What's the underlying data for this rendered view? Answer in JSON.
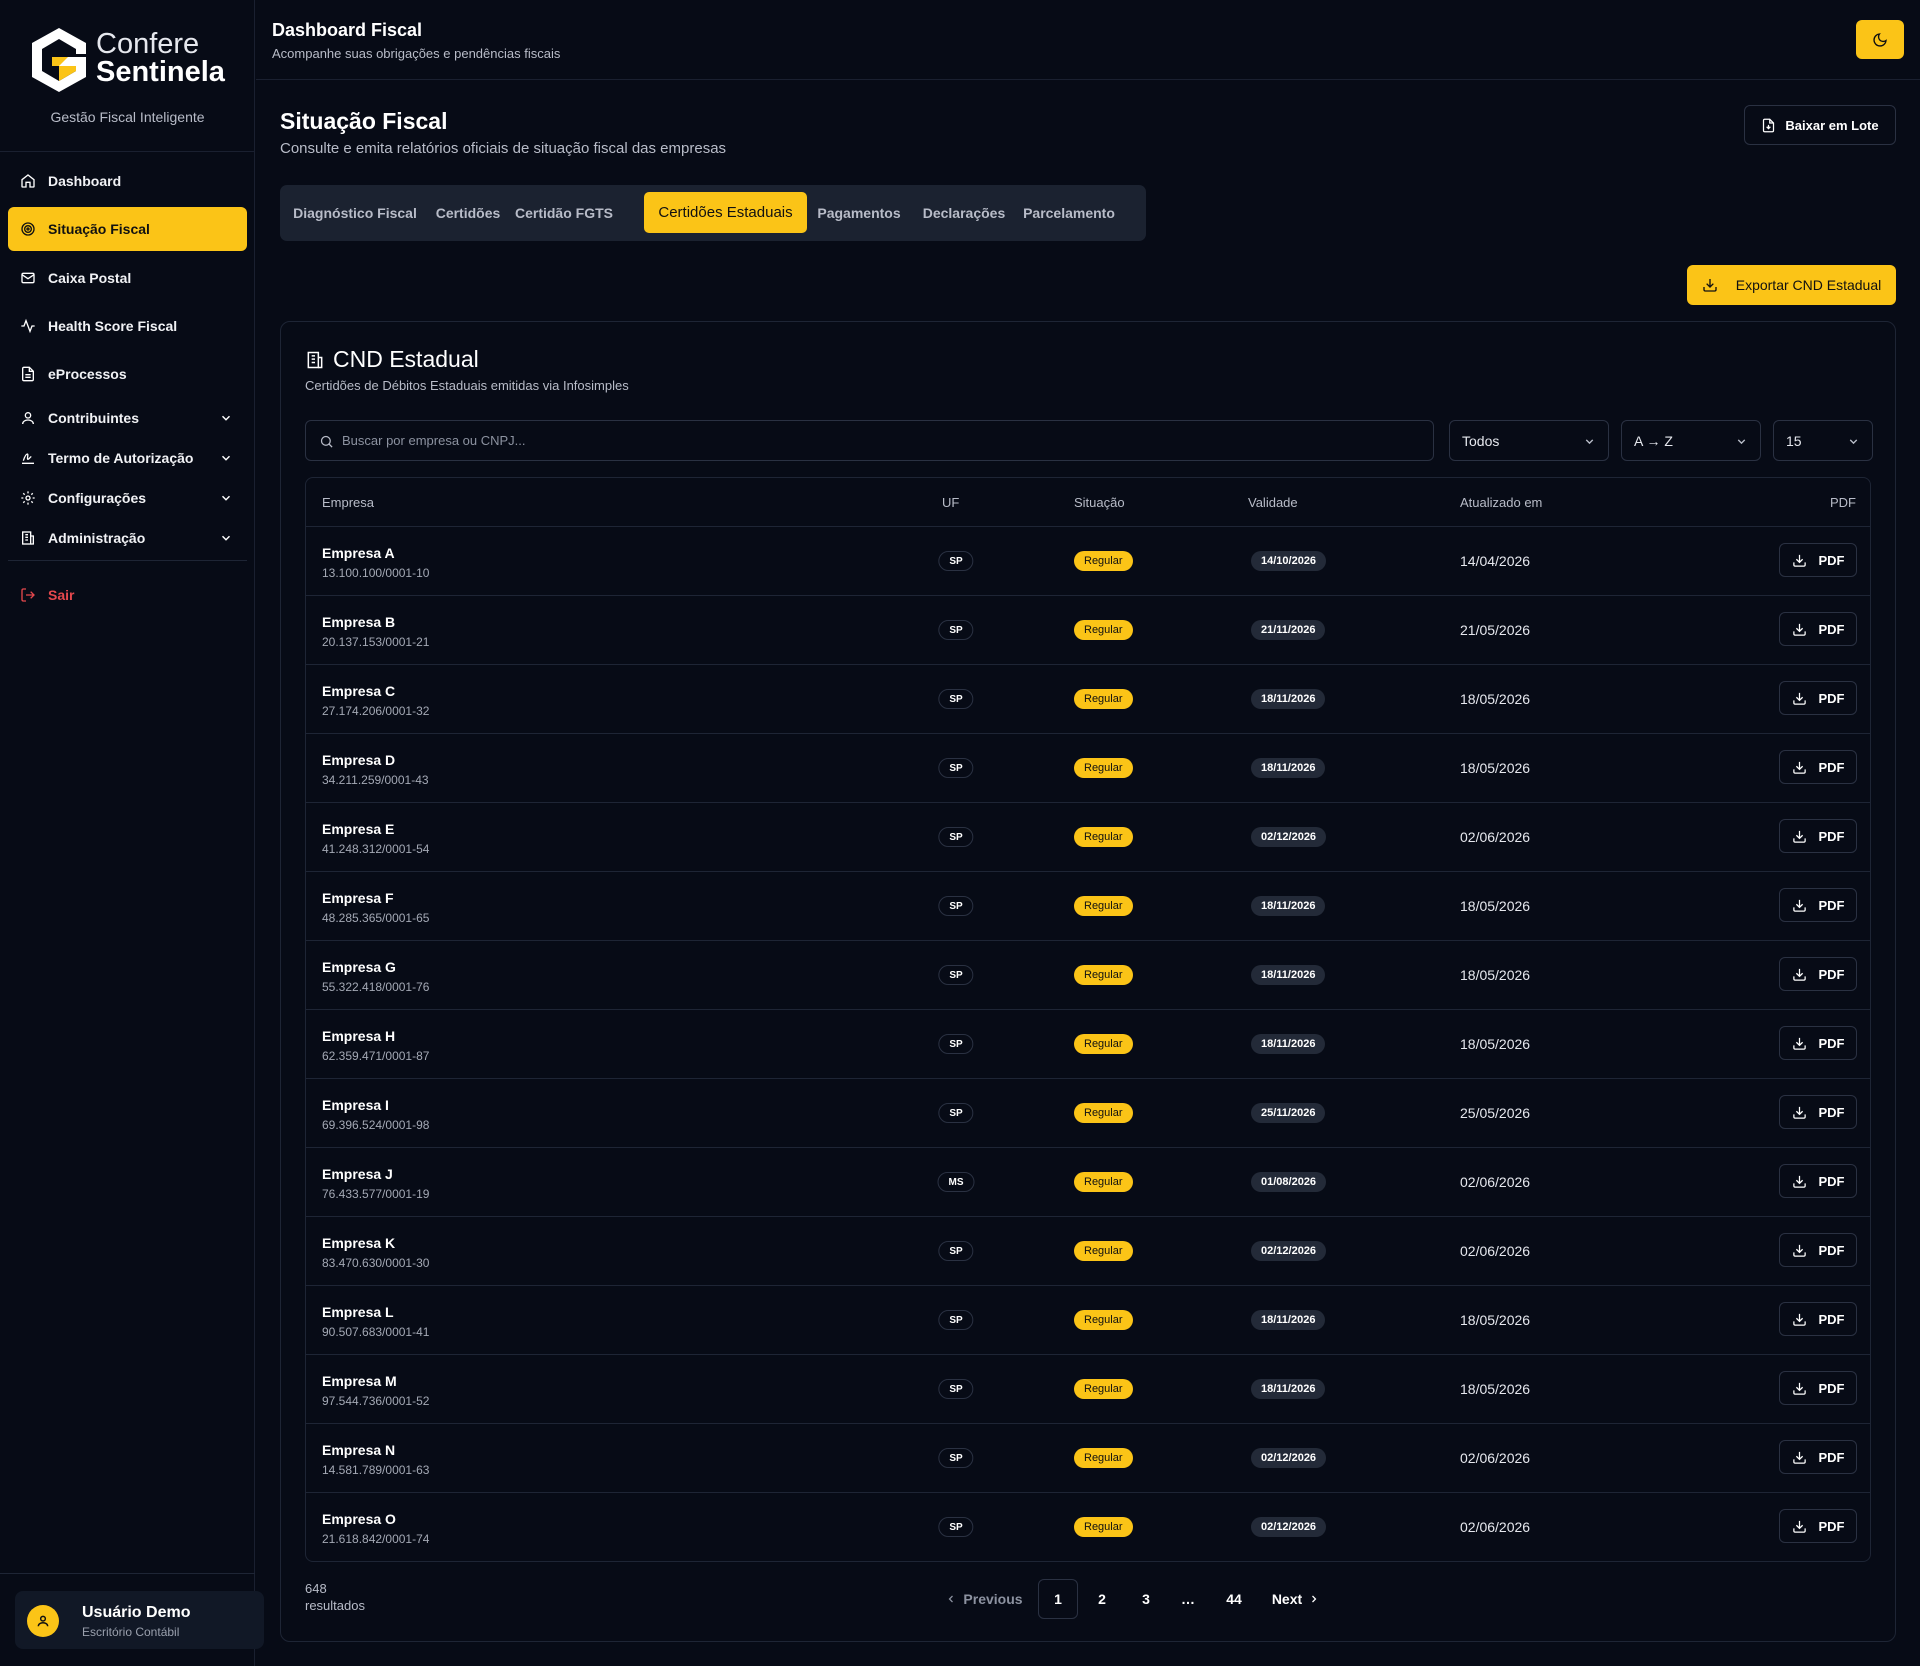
{
  "brand": {
    "name_line1": "Confere",
    "name_line2": "Sentinela",
    "tagline": "Gestão Fiscal Inteligente",
    "accent": "#fbc417"
  },
  "sidebar": {
    "items": [
      {
        "label": "Dashboard",
        "icon": "home-icon"
      },
      {
        "label": "Situação Fiscal",
        "icon": "target-icon",
        "active": true
      },
      {
        "label": "Caixa Postal",
        "icon": "mail-icon"
      },
      {
        "label": "Health Score Fiscal",
        "icon": "activity-icon"
      },
      {
        "label": "eProcessos",
        "icon": "file-text-icon"
      },
      {
        "label": "Contribuintes",
        "icon": "user-icon",
        "expandable": true
      },
      {
        "label": "Termo de Autorização",
        "icon": "signature-icon",
        "expandable": true
      },
      {
        "label": "Configurações",
        "icon": "gear-icon",
        "expandable": true
      },
      {
        "label": "Administração",
        "icon": "building-icon",
        "expandable": true
      }
    ],
    "logout": "Sair",
    "user": {
      "name": "Usuário Demo",
      "role": "Escritório Contábil"
    }
  },
  "topbar": {
    "title": "Dashboard Fiscal",
    "subtitle": "Acompanhe suas obrigações e pendências fiscais",
    "theme_icon": "moon-icon"
  },
  "page": {
    "title": "Situação Fiscal",
    "subtitle": "Consulte e emita relatórios oficiais de situação fiscal das empresas",
    "batch_button": "Baixar em Lote",
    "export_button": "Exportar CND Estadual"
  },
  "tabs": [
    "Diagnóstico Fiscal",
    "Certidões",
    "Certidão FGTS",
    "Certidões Estaduais",
    "Pagamentos",
    "Declarações",
    "Parcelamento"
  ],
  "active_tab": "Certidões Estaduais",
  "card": {
    "title": "CND Estadual",
    "subtitle": "Certidões de Débitos Estaduais emitidas via Infosimples",
    "search_placeholder": "Buscar por empresa ou CNPJ...",
    "filter_status": "Todos",
    "sort": "A → Z",
    "page_size": "15"
  },
  "table": {
    "headers": [
      "Empresa",
      "UF",
      "Situação",
      "Validade",
      "Atualizado em",
      "PDF"
    ],
    "pdf_label": "PDF",
    "rows": [
      {
        "name": "Empresa A",
        "cnpj": "13.100.100/0001-10",
        "uf": "SP",
        "status": "Regular",
        "validity": "14/10/2026",
        "updated": "14/04/2026"
      },
      {
        "name": "Empresa B",
        "cnpj": "20.137.153/0001-21",
        "uf": "SP",
        "status": "Regular",
        "validity": "21/11/2026",
        "updated": "21/05/2026"
      },
      {
        "name": "Empresa C",
        "cnpj": "27.174.206/0001-32",
        "uf": "SP",
        "status": "Regular",
        "validity": "18/11/2026",
        "updated": "18/05/2026"
      },
      {
        "name": "Empresa D",
        "cnpj": "34.211.259/0001-43",
        "uf": "SP",
        "status": "Regular",
        "validity": "18/11/2026",
        "updated": "18/05/2026"
      },
      {
        "name": "Empresa E",
        "cnpj": "41.248.312/0001-54",
        "uf": "SP",
        "status": "Regular",
        "validity": "02/12/2026",
        "updated": "02/06/2026"
      },
      {
        "name": "Empresa F",
        "cnpj": "48.285.365/0001-65",
        "uf": "SP",
        "status": "Regular",
        "validity": "18/11/2026",
        "updated": "18/05/2026"
      },
      {
        "name": "Empresa G",
        "cnpj": "55.322.418/0001-76",
        "uf": "SP",
        "status": "Regular",
        "validity": "18/11/2026",
        "updated": "18/05/2026"
      },
      {
        "name": "Empresa H",
        "cnpj": "62.359.471/0001-87",
        "uf": "SP",
        "status": "Regular",
        "validity": "18/11/2026",
        "updated": "18/05/2026"
      },
      {
        "name": "Empresa I",
        "cnpj": "69.396.524/0001-98",
        "uf": "SP",
        "status": "Regular",
        "validity": "25/11/2026",
        "updated": "25/05/2026"
      },
      {
        "name": "Empresa J",
        "cnpj": "76.433.577/0001-19",
        "uf": "MS",
        "status": "Regular",
        "validity": "01/08/2026",
        "updated": "02/06/2026"
      },
      {
        "name": "Empresa K",
        "cnpj": "83.470.630/0001-30",
        "uf": "SP",
        "status": "Regular",
        "validity": "02/12/2026",
        "updated": "02/06/2026"
      },
      {
        "name": "Empresa L",
        "cnpj": "90.507.683/0001-41",
        "uf": "SP",
        "status": "Regular",
        "validity": "18/11/2026",
        "updated": "18/05/2026"
      },
      {
        "name": "Empresa M",
        "cnpj": "97.544.736/0001-52",
        "uf": "SP",
        "status": "Regular",
        "validity": "18/11/2026",
        "updated": "18/05/2026"
      },
      {
        "name": "Empresa N",
        "cnpj": "14.581.789/0001-63",
        "uf": "SP",
        "status": "Regular",
        "validity": "02/12/2026",
        "updated": "02/06/2026"
      },
      {
        "name": "Empresa O",
        "cnpj": "21.618.842/0001-74",
        "uf": "SP",
        "status": "Regular",
        "validity": "02/12/2026",
        "updated": "02/06/2026"
      }
    ]
  },
  "pagination": {
    "total": "648",
    "total_label": "resultados",
    "previous": "Previous",
    "next": "Next",
    "pages": [
      "1",
      "2",
      "3",
      "…",
      "44"
    ],
    "current": "1"
  }
}
